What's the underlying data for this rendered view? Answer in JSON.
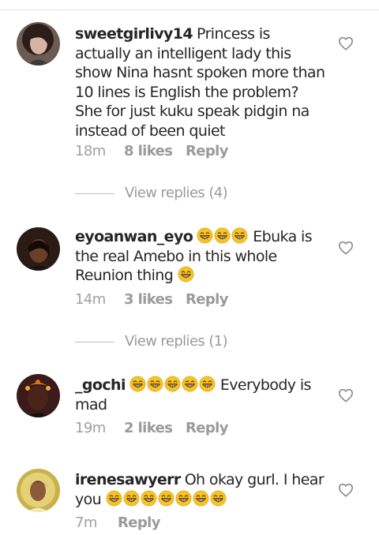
{
  "comments": [
    {
      "username": "sweetgirlivy14",
      "text": "Princess is actually an intelligent lady this show Nina hasnt spoken more than 10 lines is English the problem? She for just kuku speak pidgin na instead of been quiet",
      "time": "18m",
      "likes": "8 likes",
      "reply": "Reply",
      "view_replies": "View replies (4)"
    },
    {
      "username": "eyoanwan_eyo",
      "text": "Ebuka is the real Amebo in this whole Reunion thing",
      "time": "14m",
      "likes": "3 likes",
      "reply": "Reply",
      "view_replies": "View replies (1)"
    },
    {
      "username": "_gochi",
      "text": "Everybody is mad",
      "time": "19m",
      "likes": "2 likes",
      "reply": "Reply"
    },
    {
      "username": "irenesawyerr",
      "text": "Oh okay gurl. I hear you",
      "time": "7m",
      "reply": "Reply"
    }
  ],
  "icons": {
    "like": "heart-outline-icon",
    "emoji": "grinning-face-with-smiling-eyes-emoji"
  },
  "colors": {
    "text": "#262626",
    "muted": "#9a9a9a",
    "emoji": "#f7c325"
  }
}
